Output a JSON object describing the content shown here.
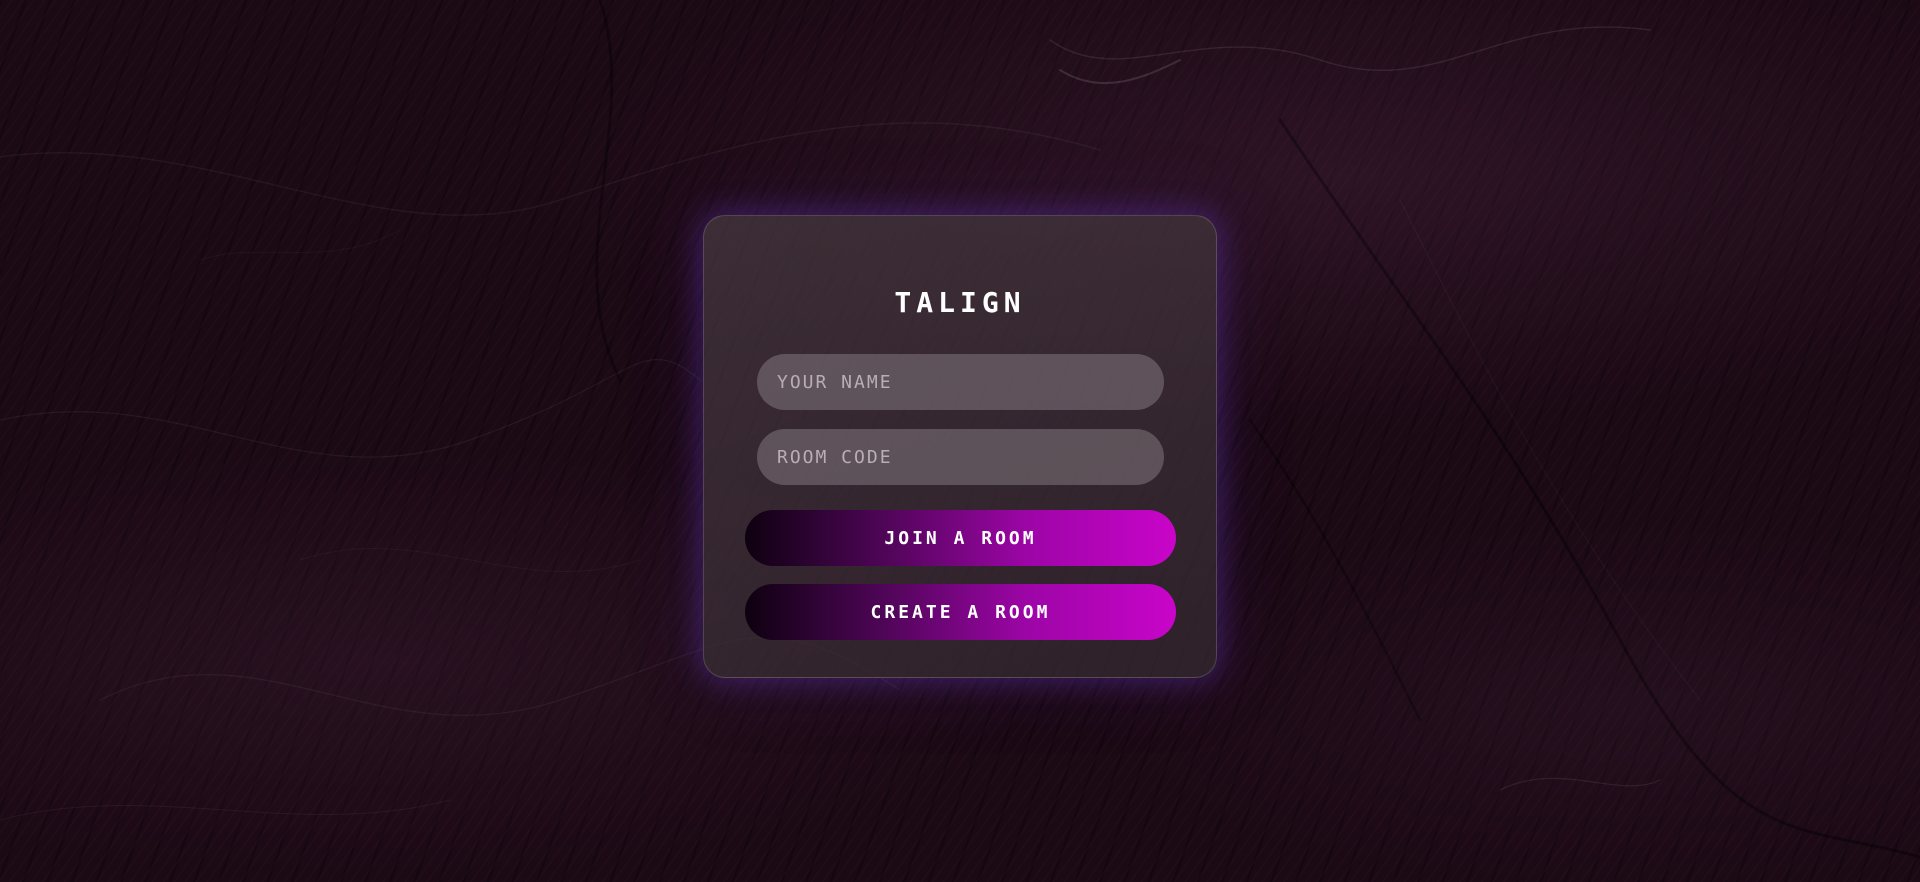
{
  "app": {
    "title": "TALIGN"
  },
  "form": {
    "name_placeholder": "YOUR NAME",
    "name_value": "",
    "room_code_placeholder": "ROOM CODE",
    "room_code_value": "",
    "join_label": "JOIN A ROOM",
    "create_label": "CREATE A ROOM"
  },
  "colors": {
    "background": "#1b0914",
    "card": "#3e3038",
    "field": "#6f6570",
    "button_start": "#0e0110",
    "button_end": "#c905c9",
    "glow": "#6e3cd2",
    "text": "#ffffff"
  }
}
